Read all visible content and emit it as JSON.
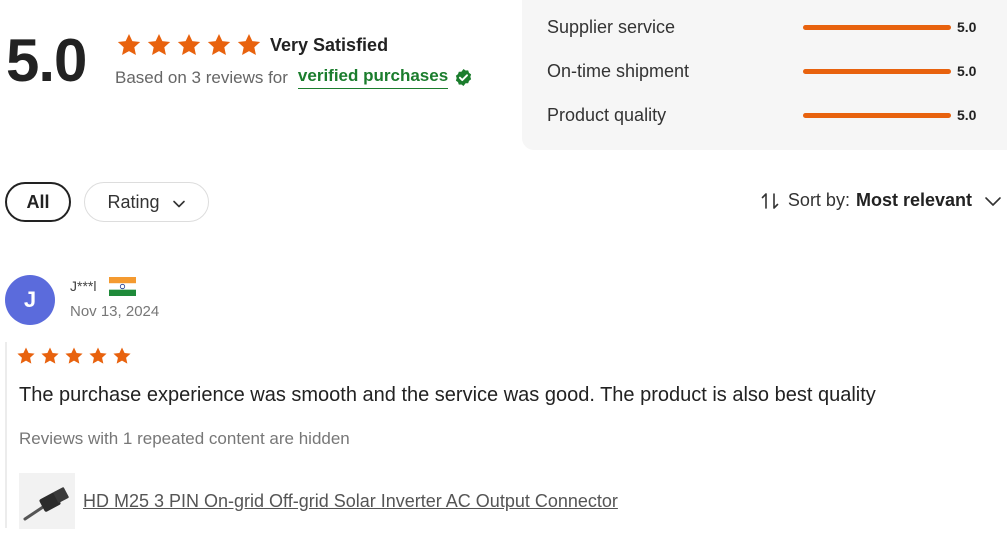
{
  "summary": {
    "score": "5.0",
    "star_count": 5,
    "satisfaction": "Very Satisfied",
    "based_on": "Based on 3 reviews for",
    "verified_label": "verified purchases",
    "star_color": "#e8620e",
    "verified_color": "#1b7d2d",
    "icons": {
      "star": "star-icon",
      "verified": "verified-check-icon"
    }
  },
  "breakdown": [
    {
      "label": "Supplier service",
      "value": "5.0",
      "fraction": 1.0
    },
    {
      "label": "On-time shipment",
      "value": "5.0",
      "fraction": 1.0
    },
    {
      "label": "Product quality",
      "value": "5.0",
      "fraction": 1.0
    }
  ],
  "filters": {
    "all_label": "All",
    "rating_label": "Rating",
    "rating_icon": "chevron-down-icon"
  },
  "sort": {
    "label": "Sort by:",
    "value": "Most relevant",
    "icons": {
      "sort": "sort-arrows-icon",
      "dropdown": "chevron-down-icon"
    }
  },
  "review": {
    "avatar_letter": "J",
    "avatar_color": "#5b6bdc",
    "reviewer": "J***l",
    "country_flag": "india-flag-icon",
    "date": "Nov 13, 2024",
    "rating": 5,
    "text": "The purchase experience was smooth and the service was good. The product is also best quality",
    "hidden_note": "Reviews with 1 repeated content are hidden",
    "product_name": "HD M25 3 PIN On-grid Off-grid Solar Inverter AC Output Connector"
  }
}
